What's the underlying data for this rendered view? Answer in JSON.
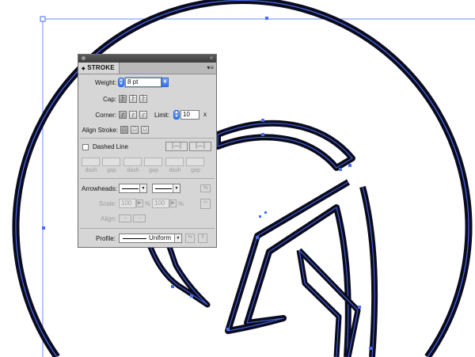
{
  "panel": {
    "tab_label": "STROKE",
    "tab_arrow": "◆",
    "collapse_glyph": "«",
    "menu_glyph": "▾≡",
    "weight": {
      "label": "Weight:",
      "value": "8 pt"
    },
    "cap": {
      "label": "Cap:"
    },
    "corner": {
      "label": "Corner:",
      "limit_label": "Limit:",
      "limit_value": "10",
      "limit_unit": "x"
    },
    "align_stroke": {
      "label": "Align Stroke:"
    },
    "dashed_line": {
      "label": "Dashed Line",
      "checked": false
    },
    "dash_labels": [
      "dash",
      "gap",
      "dash",
      "gap",
      "dash",
      "gap"
    ],
    "arrowheads": {
      "label": "Arrowheads:"
    },
    "scale": {
      "label": "Scale:",
      "start_value": "100",
      "start_unit": "%",
      "end_value": "100",
      "end_unit": "%"
    },
    "align": {
      "label": "Align:"
    },
    "profile": {
      "label": "Profile:",
      "value": "Uniform"
    }
  },
  "colors": {
    "selection": "#4a6cf0",
    "outline": "#0b0b1e",
    "panel_bg": "#d6d6d6",
    "accent": "#2f74e8"
  }
}
